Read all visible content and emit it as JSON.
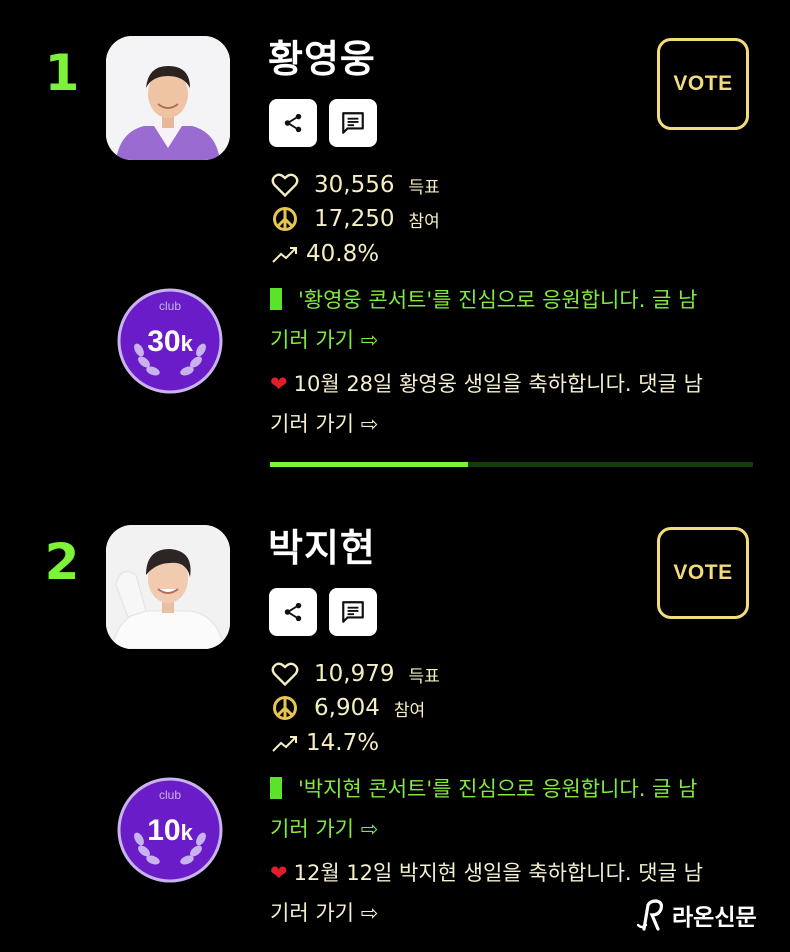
{
  "entries": [
    {
      "rank": "1",
      "name": "황영웅",
      "vote_label": "VOTE",
      "votes": "30,556",
      "votes_unit": "득표",
      "participants": "17,250",
      "participants_unit": "참여",
      "trend": "40.8%",
      "badge_top": "club",
      "badge_value": "30",
      "badge_suffix": "k",
      "msg1_line1": "'황영웅 콘서트'를 진심으로 응원합니다. 글 남",
      "msg1_line2": "기러 가기 ⇨",
      "msg2_line1": "10월 28일 황영웅 생일을 축하합니다. 댓글 남",
      "msg2_line2": "기러 가기 ⇨",
      "progress": 0.41
    },
    {
      "rank": "2",
      "name": "박지현",
      "vote_label": "VOTE",
      "votes": "10,979",
      "votes_unit": "득표",
      "participants": "6,904",
      "participants_unit": "참여",
      "trend": "14.7%",
      "badge_top": "club",
      "badge_value": "10",
      "badge_suffix": "k",
      "msg1_line1": "'박지현 콘서트'를 진심으로 응원합니다. 글 남",
      "msg1_line2": "기러 가기 ⇨",
      "msg2_line1": "12월 12일 박지현 생일을 축하합니다. 댓글 남",
      "msg2_line2": "기러 가기 ⇨"
    }
  ],
  "watermark": "라온신문",
  "icons": {
    "share": "share-icon",
    "comment": "comment-icon",
    "heart": "heart-outline-icon",
    "peace": "peace-icon",
    "trend": "trend-up-icon"
  },
  "colors": {
    "rank": "#7cf23a",
    "vote_border": "#f3dc7d",
    "stat_text": "#f5eec0",
    "green_text": "#82ea3e",
    "badge_purple": "#6a1cc9",
    "progress_fill": "#7cf23a",
    "progress_track": "#143d0b"
  }
}
